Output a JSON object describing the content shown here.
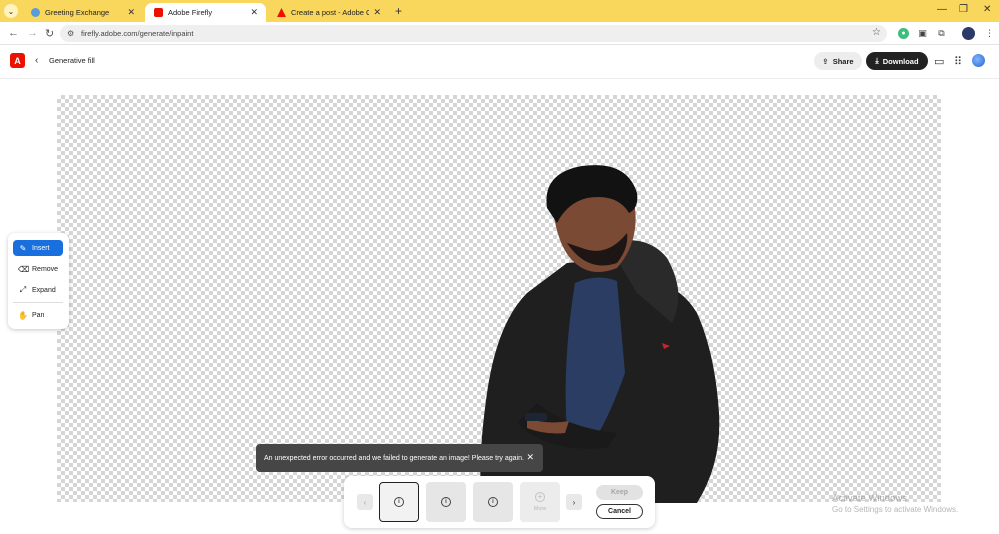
{
  "browser": {
    "tabs": [
      {
        "title": "Greeting Exchange",
        "active": false
      },
      {
        "title": "Adobe Firefly",
        "active": true
      },
      {
        "title": "Create a post - Adobe Commu",
        "active": false
      }
    ],
    "url": "firefly.adobe.com/generate/inpaint"
  },
  "header": {
    "logo": "A",
    "title": "Generative fill",
    "share_label": "Share",
    "download_label": "Download"
  },
  "tools": [
    {
      "label": "Insert",
      "icon": "insert-brush-icon",
      "active": true
    },
    {
      "label": "Remove",
      "icon": "remove-brush-icon",
      "active": false
    },
    {
      "label": "Expand",
      "icon": "expand-icon",
      "active": false
    },
    {
      "label": "Pan",
      "icon": "hand-icon",
      "active": false
    }
  ],
  "toast": {
    "message": "An unexpected error occurred and we failed to generate an image! Please try again."
  },
  "generation": {
    "more_label": "More",
    "keep_label": "Keep",
    "cancel_label": "Cancel"
  },
  "watermark": {
    "line1": "Activate Windows",
    "line2": "Go to Settings to activate Windows."
  },
  "colors": {
    "tab_strip": "#f9d65c",
    "accent_blue": "#1a6fdf",
    "adobe_red": "#eb1000"
  }
}
